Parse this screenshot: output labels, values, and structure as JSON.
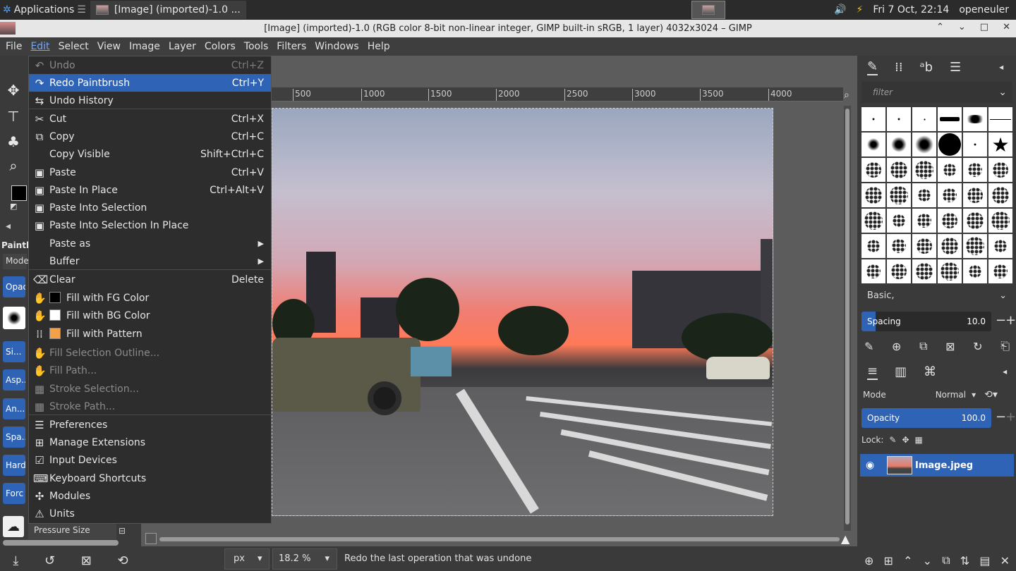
{
  "taskbar": {
    "applications": "Applications",
    "task_title": "[Image] (imported)-1.0 ...",
    "datetime": "Fri  7 Oct, 22:14",
    "user": "openeuler"
  },
  "window": {
    "title": "[Image] (imported)-1.0 (RGB color 8-bit non-linear integer, GIMP built-in sRGB, 1 layer) 4032x3024 – GIMP"
  },
  "menubar": [
    "File",
    "Edit",
    "Select",
    "View",
    "Image",
    "Layer",
    "Colors",
    "Tools",
    "Filters",
    "Windows",
    "Help"
  ],
  "edit_menu": [
    {
      "label": "Undo",
      "shortcut": "Ctrl+Z",
      "icon": "undo-icon",
      "disabled": true
    },
    {
      "label": "Redo Paintbrush",
      "shortcut": "Ctrl+Y",
      "icon": "redo-icon",
      "highlighted": true
    },
    {
      "label": "Undo History",
      "shortcut": "",
      "icon": "undo-history-icon"
    },
    {
      "label": "Cut",
      "shortcut": "Ctrl+X",
      "icon": "scissors-icon"
    },
    {
      "label": "Copy",
      "shortcut": "Ctrl+C",
      "icon": "copy-icon"
    },
    {
      "label": "Copy Visible",
      "shortcut": "Shift+Ctrl+C",
      "icon": ""
    },
    {
      "label": "Paste",
      "shortcut": "Ctrl+V",
      "icon": "paste-icon"
    },
    {
      "label": "Paste In Place",
      "shortcut": "Ctrl+Alt+V",
      "icon": "paste-icon"
    },
    {
      "label": "Paste Into Selection",
      "shortcut": "",
      "icon": "paste-icon"
    },
    {
      "label": "Paste Into Selection In Place",
      "shortcut": "",
      "icon": "paste-icon"
    },
    {
      "label": "Paste as",
      "shortcut": "",
      "icon": "",
      "submenu": true
    },
    {
      "label": "Buffer",
      "shortcut": "",
      "icon": "",
      "submenu": true
    },
    {
      "label": "Clear",
      "shortcut": "Delete",
      "icon": "clear-icon"
    },
    {
      "label": "Fill with FG Color",
      "shortcut": "",
      "icon": "bucket-icon",
      "swatch": "#000000"
    },
    {
      "label": "Fill with BG Color",
      "shortcut": "",
      "icon": "bucket-icon",
      "swatch": "#ffffff"
    },
    {
      "label": "Fill with Pattern",
      "shortcut": "",
      "icon": "pattern-icon",
      "swatch": "#f2a14a"
    },
    {
      "label": "Fill Selection Outline...",
      "shortcut": "",
      "icon": "bucket-icon",
      "disabled": true
    },
    {
      "label": "Fill Path...",
      "shortcut": "",
      "icon": "bucket-icon",
      "disabled": true
    },
    {
      "label": "Stroke Selection...",
      "shortcut": "",
      "icon": "stroke-icon",
      "disabled": true
    },
    {
      "label": "Stroke Path...",
      "shortcut": "",
      "icon": "stroke-icon",
      "disabled": true
    },
    {
      "label": "Preferences",
      "shortcut": "",
      "icon": "preferences-icon"
    },
    {
      "label": "Manage Extensions",
      "shortcut": "",
      "icon": "extensions-icon"
    },
    {
      "label": "Input Devices",
      "shortcut": "",
      "icon": "input-devices-icon"
    },
    {
      "label": "Keyboard Shortcuts",
      "shortcut": "",
      "icon": "keyboard-icon"
    },
    {
      "label": "Modules",
      "shortcut": "",
      "icon": "modules-icon"
    },
    {
      "label": "Units",
      "shortcut": "",
      "icon": "units-icon"
    }
  ],
  "toolbox": {
    "tool_options_title": "Paintb",
    "mode_label": "Mode",
    "option_buttons": [
      "Opac",
      "Si...",
      "Asp...",
      "An...",
      "Spa...",
      "Hard",
      "Forc"
    ],
    "pressure_label": "Pressure Size"
  },
  "ruler": [
    "500",
    "1000",
    "1500",
    "2000",
    "2500",
    "3000",
    "3500",
    "4000"
  ],
  "statusbar": {
    "unit": "px",
    "zoom": "18.2 %",
    "message": "Redo the last operation that was undone"
  },
  "dock": {
    "filter_placeholder": "filter",
    "brush_preset": "Basic,",
    "spacing_label": "Spacing",
    "spacing_value": "10.0",
    "spacing_fraction": 0.1,
    "layer_mode_label": "Mode",
    "layer_mode_value": "Normal",
    "opacity_label": "Opacity",
    "opacity_value": "100.0",
    "opacity_fraction": 1.0,
    "lock_label": "Lock:",
    "layer_name": "Image.jpeg"
  },
  "colors": {
    "accent": "#2f63b5",
    "menu_bg": "#2d2d2d",
    "selection_border": "#e8e800"
  }
}
